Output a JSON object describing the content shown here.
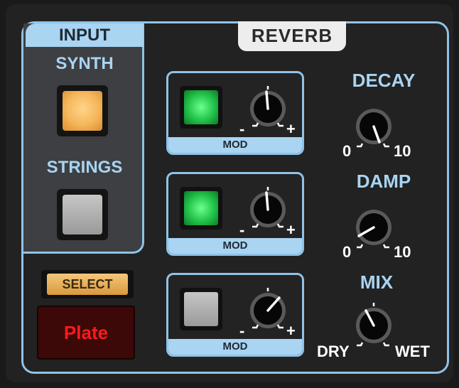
{
  "input": {
    "tab_label": "INPUT",
    "synth_label": "SYNTH",
    "strings_label": "STRINGS",
    "synth_active": true,
    "strings_active": false
  },
  "reverb": {
    "title": "REVERB",
    "mod_rows": [
      {
        "label": "MOD",
        "button_on": true,
        "minus": "-",
        "plus": "+"
      },
      {
        "label": "MOD",
        "button_on": true,
        "minus": "-",
        "plus": "+"
      },
      {
        "label": "MOD",
        "button_on": false,
        "minus": "-",
        "plus": "+"
      }
    ],
    "decay": {
      "label": "DECAY",
      "min": "0",
      "max": "10"
    },
    "damp": {
      "label": "DAMP",
      "min": "0",
      "max": "10"
    },
    "mix": {
      "label": "MIX",
      "min": "DRY",
      "max": "WET"
    },
    "select_label": "SELECT",
    "display_value": "Plate"
  },
  "colors": {
    "accent": "#a9d4f2",
    "frame": "#8fc3e8",
    "synth_on": "#f5b65a",
    "button_off": "#b8b8b8",
    "led_green": "#22c34a",
    "display_text": "#ff1a1a"
  }
}
